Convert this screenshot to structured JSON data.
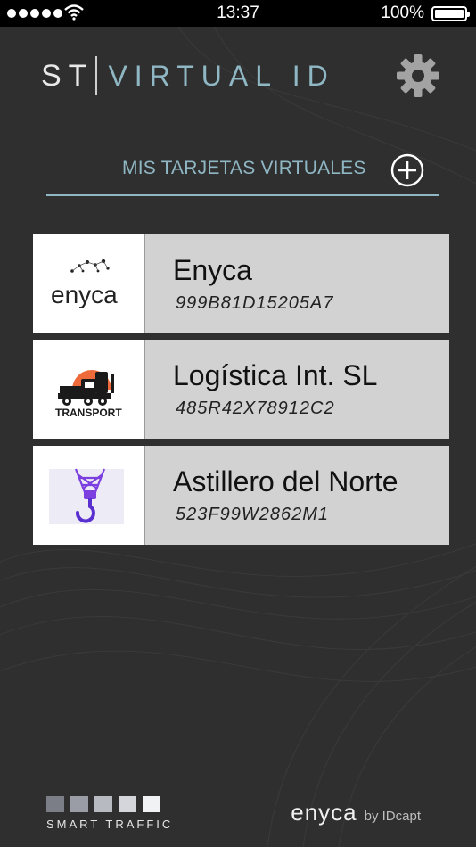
{
  "status_bar": {
    "time": "13:37",
    "battery_percent": "100%",
    "battery_level": 1.0,
    "signal_bars": 5
  },
  "header": {
    "brand_st": "ST",
    "brand_virtual_id": "VIRTUAL ID",
    "settings_icon": "gear-icon"
  },
  "section": {
    "title": "MIS TARJETAS VIRTUALES",
    "add_icon": "plus-circle-icon"
  },
  "cards": [
    {
      "name": "Enyca",
      "code": "999B81D15205A7",
      "logo_text": "enyca",
      "logo_icon": "enyca-logo"
    },
    {
      "name": "Logística Int. SL",
      "code": "485R42X78912C2",
      "logo_text": "TRANSPORT",
      "logo_icon": "truck-logo"
    },
    {
      "name": "Astillero del Norte",
      "code": "523F99W2862M1",
      "logo_icon": "crane-hook-logo"
    }
  ],
  "footer": {
    "left_brand": "SMART TRAFFIC",
    "left_squares": [
      "#7b7e86",
      "#9a9da5",
      "#b8bac1",
      "#d4d6db",
      "#f1f2f4"
    ],
    "right_brand": "enyca",
    "right_suffix": "by IDcapt"
  },
  "colors": {
    "background": "#2f2f2f",
    "accent": "#8fb7c4",
    "card_info_bg": "#d2d2d2"
  }
}
